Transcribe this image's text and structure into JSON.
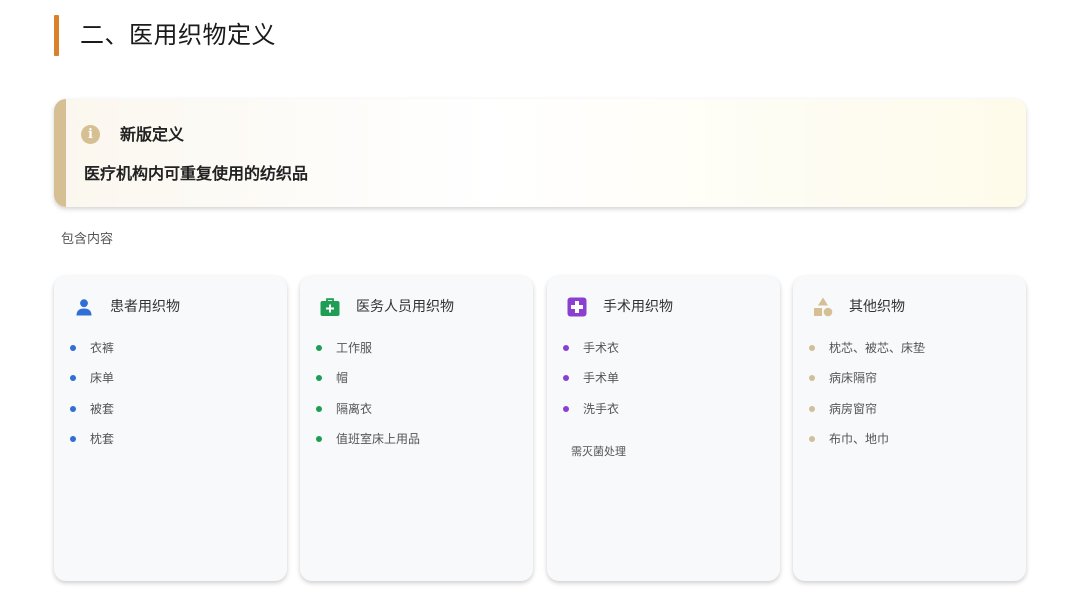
{
  "page": {
    "title": "二、医用织物定义"
  },
  "definition": {
    "icon": "info-icon",
    "title": "新版定义",
    "body": "医疗机构内可重复使用的纺织品"
  },
  "section_label": "包含内容",
  "colors": {
    "title_accent": "#d9822b",
    "definition_accent": "#d7bf94",
    "patient": "#2f6fd6",
    "staff": "#1f9d55",
    "surgery": "#8a3fd1",
    "other": "#d7bf94"
  },
  "categories": [
    {
      "icon": "person-icon",
      "title": "患者用织物",
      "items": [
        "衣裤",
        "床单",
        "被套",
        "枕套"
      ],
      "note": ""
    },
    {
      "icon": "medical-bag-icon",
      "title": "医务人员用织物",
      "items": [
        "工作服",
        "帽",
        "隔离衣",
        "值班室床上用品"
      ],
      "note": ""
    },
    {
      "icon": "medical-cross-icon",
      "title": "手术用织物",
      "items": [
        "手术衣",
        "手术单",
        "洗手衣"
      ],
      "note": "需灭菌处理"
    },
    {
      "icon": "shapes-icon",
      "title": "其他织物",
      "items": [
        "枕芯、被芯、床垫",
        "病床隔帘",
        "病房窗帘",
        "布巾、地巾"
      ],
      "note": ""
    }
  ]
}
